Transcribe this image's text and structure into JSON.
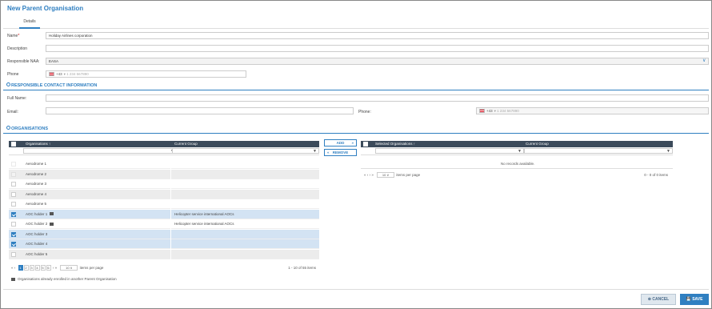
{
  "title": "New Parent Organisation",
  "tabs": [
    "Details"
  ],
  "form": {
    "name_label": "Name",
    "name_required": "*",
    "name_value": "Holiday Airlines corporation",
    "description_label": "Description",
    "naa_label": "Responsible NAA:",
    "naa_value": "EASA",
    "phone_label": "Phone",
    "phone_prefix": "+43",
    "phone_placeholder": "1 234 567890"
  },
  "contact_section": {
    "title": "RESPONSIBLE CONTACT INFORMATION",
    "fullname_label": "Full Name:",
    "email_label": "Email:",
    "phone_label": "Phone:",
    "phone_prefix": "+43",
    "phone_placeholder": "1 234 567890"
  },
  "org_section": {
    "title": "ORGANISATIONS"
  },
  "left_grid": {
    "col1": "Organisations",
    "col2": "Current Group",
    "rows": [
      {
        "name": "Aerodrome 1",
        "group": "",
        "checked": false,
        "disabled": true,
        "building": false
      },
      {
        "name": "Aerodrome 2",
        "group": "",
        "checked": false,
        "disabled": true,
        "building": false
      },
      {
        "name": "Aerodrome 3",
        "group": "",
        "checked": false,
        "disabled": false,
        "building": false
      },
      {
        "name": "Aerodrome 4",
        "group": "",
        "checked": false,
        "disabled": false,
        "building": false
      },
      {
        "name": "Aerodrome 5",
        "group": "",
        "checked": false,
        "disabled": false,
        "building": false
      },
      {
        "name": "AOC holder 1",
        "group": "Helicopter service international AOCs",
        "checked": true,
        "disabled": false,
        "building": true
      },
      {
        "name": "AOC holder 2",
        "group": "Helicopter service international AOCs",
        "checked": false,
        "disabled": false,
        "building": true
      },
      {
        "name": "AOC holder 3",
        "group": "",
        "checked": true,
        "disabled": false,
        "building": false
      },
      {
        "name": "AOC holder 4",
        "group": "",
        "checked": true,
        "disabled": false,
        "building": false
      },
      {
        "name": "AOC holder 5",
        "group": "",
        "checked": false,
        "disabled": false,
        "building": false
      }
    ],
    "pages": [
      "1",
      "2",
      "3",
      "4",
      "5",
      "6"
    ],
    "page_size": "10",
    "items_per_page": "items per page",
    "range": "1 - 10 of 55 items"
  },
  "buttons": {
    "add": "ADD",
    "remove": "REMOVE",
    "cancel": "CANCEL",
    "save": "SAVE"
  },
  "right_grid": {
    "col1": "Selected Organisations",
    "col2": "Current Group",
    "empty": "No records available.",
    "page_size": "10",
    "items_per_page": "items per page",
    "range": "0 - 0 of 0 items"
  },
  "legend": "Organisations already enrolled in another Parent Organisation"
}
